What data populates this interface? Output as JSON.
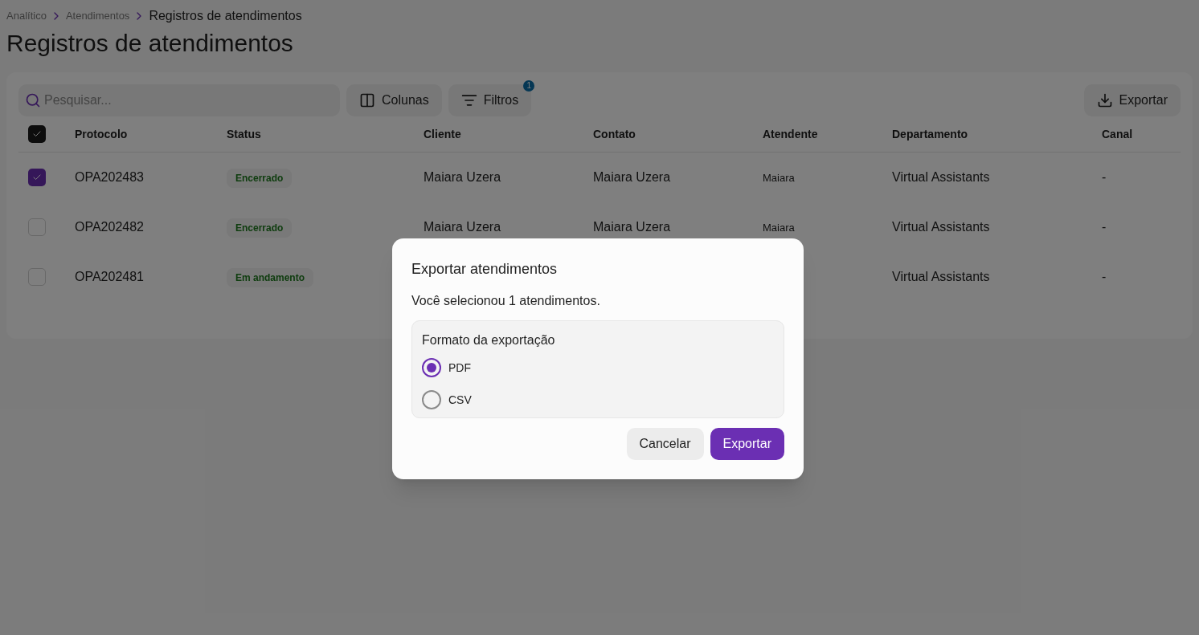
{
  "breadcrumb": [
    "Analítico",
    "Atendimentos",
    "Registros de atendimentos"
  ],
  "title": "Registros de atendimentos",
  "toolbar": {
    "search": {
      "placeholder": "Pesquisar..."
    },
    "columns_button": "Colunas",
    "filters_button": "Filtros",
    "filters_badge": "1",
    "export_button": "Exportar"
  },
  "table": {
    "all_checked": true,
    "columns": [
      "Protocolo",
      "Status",
      "Cliente",
      "Contato",
      "Atendente",
      "Departamento",
      "Canal"
    ],
    "rows": [
      {
        "checked": true,
        "protocolo": "OPA202483",
        "status": "Encerrado",
        "cliente": "Maiara Uzera",
        "contato": "Maiara Uzera",
        "atendente": "Maiara",
        "departamento": "Virtual Assistants",
        "canal": "-"
      },
      {
        "checked": false,
        "protocolo": "OPA202482",
        "status": "Encerrado",
        "cliente": "Maiara Uzera",
        "contato": "Maiara Uzera",
        "atendente": "Maiara",
        "departamento": "Virtual Assistants",
        "canal": "-"
      },
      {
        "checked": false,
        "protocolo": "OPA202481",
        "status": "Em andamento",
        "departamento": "Virtual Assistants",
        "canal": "-"
      }
    ]
  },
  "dialog": {
    "title": "Exportar atendimentos",
    "message": "Você selecionou 1 atendimentos.",
    "group_label": "Formato da exportação",
    "options": [
      {
        "label": "PDF",
        "selected": true
      },
      {
        "label": "CSV",
        "selected": false
      }
    ],
    "buttons": [
      {
        "kind": "secondary",
        "label": "Cancelar"
      },
      {
        "kind": "primary",
        "label": "Exportar"
      }
    ]
  }
}
